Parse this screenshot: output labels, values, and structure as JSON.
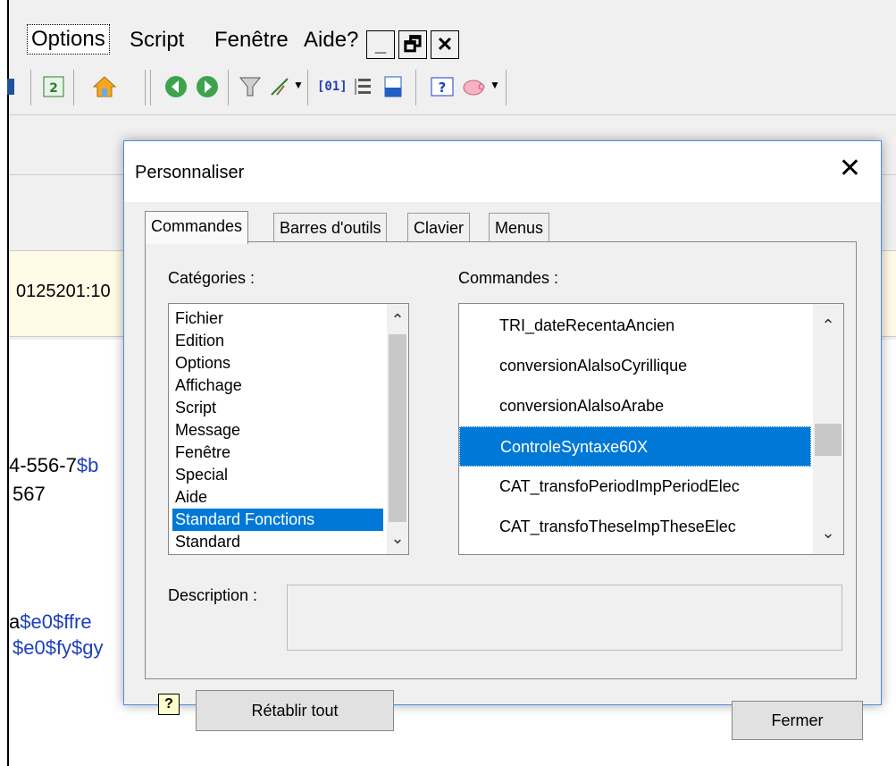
{
  "menubar": {
    "options": "Options",
    "script": "Script",
    "fenetre": "Fenêtre",
    "aide": "Aide?",
    "minimize": "_",
    "restore": "🗗",
    "close": "✕"
  },
  "toolbar": {
    "icons": [
      "save-icon",
      "refresh-icon",
      "home-icon",
      "back-icon",
      "forward-icon",
      "filter-icon",
      "tree-icon",
      "zero-one-icon",
      "outline-icon",
      "export-icon",
      "help-icon",
      "pig-icon"
    ],
    "zero_one_label": "[01]"
  },
  "background": {
    "line1": "0125201:10",
    "line2a": "4-556-7",
    "line2b": "$b",
    "line3": "567",
    "line4a": "a",
    "line4b": "$e0$ffre",
    "line5": "$e0$fy$gy"
  },
  "dialog": {
    "title": "Personnaliser",
    "close": "✕",
    "tabs": [
      "Commandes",
      "Barres d'outils",
      "Clavier",
      "Menus"
    ],
    "categories_label": "Catégories :",
    "commands_label": "Commandes :",
    "categories": [
      "Fichier",
      "Edition",
      "Options",
      "Affichage",
      "Script",
      "Message",
      "Fenêtre",
      "Special",
      "Aide",
      "Standard Fonctions",
      "Standard"
    ],
    "selected_category": "Standard Fonctions",
    "commands": [
      "TRI_dateRecentaAncien",
      "conversionAlalsoCyrillique",
      "conversionAlalsoArabe",
      "ControleSyntaxe60X",
      "CAT_transfoPeriodImpPeriodElec",
      "CAT_transfoTheseImpTheseElec"
    ],
    "selected_command": "ControleSyntaxe60X",
    "description_label": "Description :",
    "description_value": "",
    "reset_all": "Rétablir tout",
    "close_button": "Fermer",
    "help_glyph": "?"
  },
  "colors": {
    "selection": "#0078d7",
    "link_blue": "#1f3fbf",
    "window_bg": "#f0f0f0"
  }
}
